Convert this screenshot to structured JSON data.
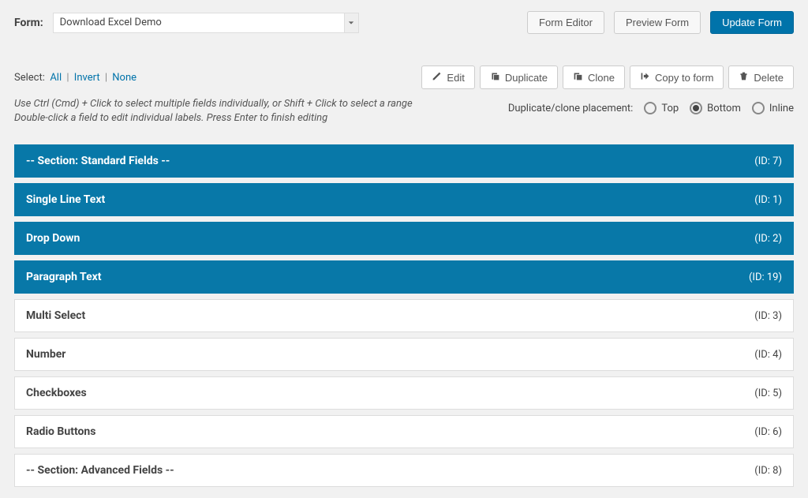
{
  "header": {
    "form_label": "Form:",
    "form_selected": "Download Excel Demo",
    "form_editor": "Form Editor",
    "preview_form": "Preview Form",
    "update_form": "Update Form"
  },
  "select": {
    "label": "Select:",
    "all": "All",
    "invert": "Invert",
    "none": "None"
  },
  "toolbar": {
    "edit": "Edit",
    "duplicate": "Duplicate",
    "clone": "Clone",
    "copy_to_form": "Copy to form",
    "delete": "Delete"
  },
  "hints": {
    "line1": "Use Ctrl (Cmd) + Click to select multiple fields individually, or Shift + Click to select a range",
    "line2": "Double-click a field to edit individual labels. Press Enter to finish editing"
  },
  "placement": {
    "label": "Duplicate/clone placement:",
    "top": "Top",
    "bottom": "Bottom",
    "inline": "Inline",
    "selected": "bottom"
  },
  "fields": [
    {
      "label": "-- Section: Standard Fields --",
      "id": "(ID: 7)",
      "selected": true
    },
    {
      "label": "Single Line Text",
      "id": "(ID: 1)",
      "selected": true
    },
    {
      "label": "Drop Down",
      "id": "(ID: 2)",
      "selected": true
    },
    {
      "label": "Paragraph Text",
      "id": "(ID: 19)",
      "selected": true
    },
    {
      "label": "Multi Select",
      "id": "(ID: 3)",
      "selected": false
    },
    {
      "label": "Number",
      "id": "(ID: 4)",
      "selected": false
    },
    {
      "label": "Checkboxes",
      "id": "(ID: 5)",
      "selected": false
    },
    {
      "label": "Radio Buttons",
      "id": "(ID: 6)",
      "selected": false
    },
    {
      "label": "-- Section: Advanced Fields --",
      "id": "(ID: 8)",
      "selected": false
    }
  ]
}
